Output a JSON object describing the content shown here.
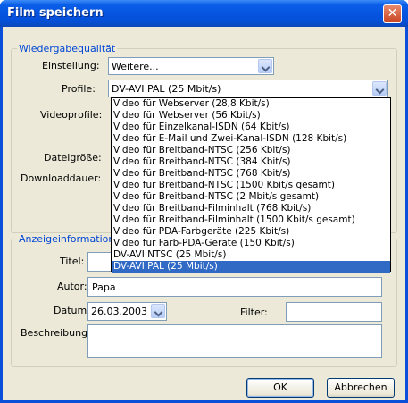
{
  "window": {
    "title": "Film speichern",
    "close_glyph": "✕"
  },
  "playback": {
    "legend": "Wiedergabequalität",
    "einstellung_label": "Einstellung:",
    "einstellung_value": "Weitere...",
    "profile_label": "Profile:",
    "profile_value": "DV-AVI PAL (25 Mbit/s)",
    "videoprofile_label": "Videoprofile:",
    "dateigroesse_label": "Dateigröße:",
    "downloaddauer_label": "Downloaddauer:",
    "profile_options": [
      "Video für Webserver (28,8 Kbit/s)",
      "Video für Webserver (56 Kbit/s)",
      "Video für Einzelkanal-ISDN (64 Kbit/s)",
      "Video für E-Mail und Zwei-Kanal-ISDN (128 Kbit/s)",
      "Video für Breitband-NTSC (256 Kbit/s)",
      "Video für Breitband-NTSC (384 Kbit/s)",
      "Video für Breitband-NTSC (768 Kbit/s)",
      "Video für Breitband-NTSC (1500 Kbit/s gesamt)",
      "Video für Breitband-NTSC (2 Mbit/s gesamt)",
      "Video für Breitband-Filminhalt (768 Kbit/s)",
      "Video für Breitband-Filminhalt (1500 Kbit/s gesamt)",
      "Video für PDA-Farbgeräte (225 Kbit/s)",
      "Video für Farb-PDA-Geräte (150 Kbit/s)",
      "DV-AVI NTSC (25 Mbit/s)",
      "DV-AVI PAL (25 Mbit/s)"
    ],
    "selected_option_index": 14
  },
  "info": {
    "legend": "Anzeigeinformationen",
    "titel_label": "Titel:",
    "titel_value": "",
    "autor_label": "Autor:",
    "autor_value": "Papa",
    "datum_label": "Datum:",
    "datum_value": "26.03.2003",
    "filter_label": "Filter:",
    "filter_value": "",
    "beschreibung_label": "Beschreibung:",
    "beschreibung_value": ""
  },
  "buttons": {
    "ok": "OK",
    "cancel": "Abbrechen"
  }
}
